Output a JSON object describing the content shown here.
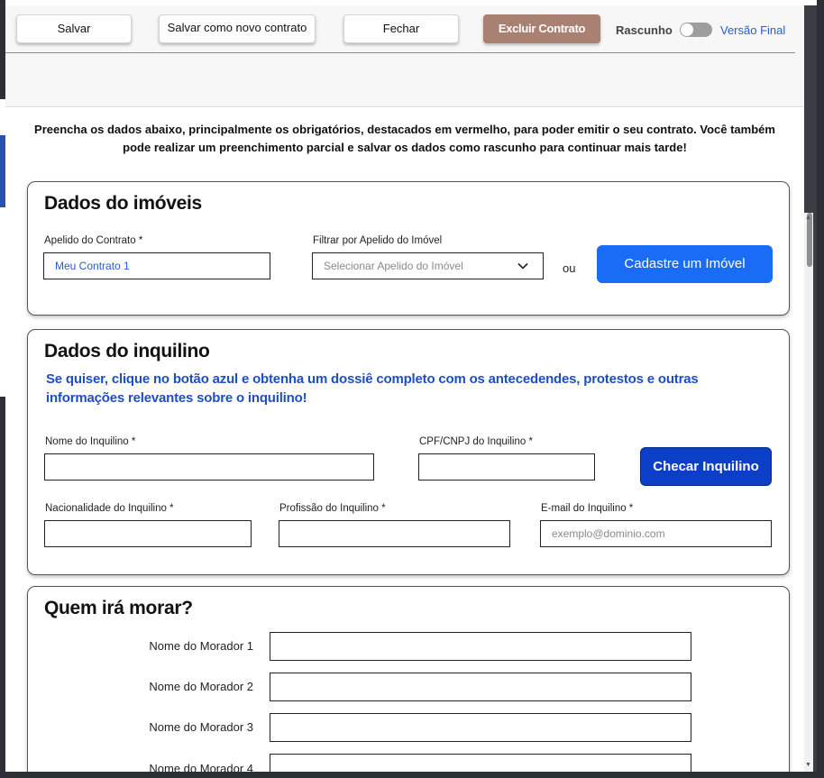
{
  "toolbar": {
    "save": "Salvar",
    "save_new": "Salvar como novo contrato",
    "close": "Fechar",
    "delete": "Excluir Contrato",
    "draft_label": "Rascunho",
    "final_label": "Versão Final"
  },
  "intro": "Preencha os dados abaixo, principalmente os obrigatórios, destacados em vermelho, para poder emitir o seu contrato. Você também pode realizar um preenchimento parcial e salvar os dados como rascunho para continuar mais tarde!",
  "property": {
    "title": "Dados do imóveis",
    "nickname_label": "Apelido do Contrato *",
    "nickname_value": "Meu Contrato 1",
    "filter_label": "Filtrar por Apelido do Imóvel",
    "filter_placeholder": "Selecionar Apelido do Imóvel",
    "or": "ou",
    "register_button": "Cadastre um Imóvel"
  },
  "tenant": {
    "title": "Dados do inquilino",
    "hint": "Se quiser, clique no botão azul e obtenha um dossiê completo com os antecedendes, protestos e outras informações relevantes sobre o inquilino!",
    "name_label": "Nome do Inquilino *",
    "cpf_label": "CPF/CNPJ do Inquilino *",
    "check_button": "Checar Inquilino",
    "nationality_label": "Nacionalidade do Inquilino *",
    "profession_label": "Profissão do Inquilino *",
    "email_label": "E-mail do Inquilino *",
    "email_placeholder": "exemplo@dominio.com"
  },
  "residents": {
    "title": "Quem irá morar?",
    "labels": [
      "Nome do Morador 1",
      "Nome do Morador 2",
      "Nome do Morador 3",
      "Nome do Morador 4"
    ]
  },
  "colors": {
    "primary": "#1a6cf6",
    "dark_primary": "#0b3fc7",
    "danger": "#a98173",
    "link": "#2a5ccf"
  }
}
